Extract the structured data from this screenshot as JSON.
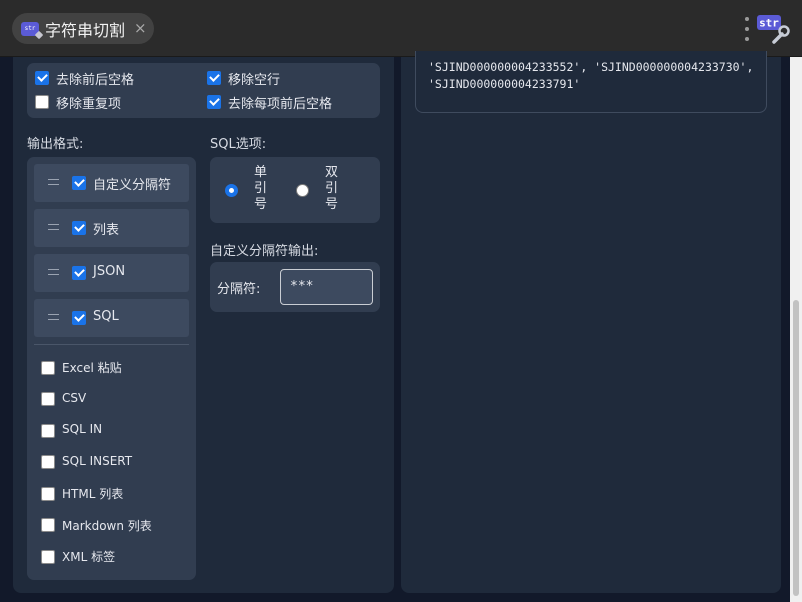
{
  "titlebar": {
    "tab_icon_text": "str",
    "tab_title": "字符串切割",
    "close_glyph": "×",
    "logo_text": "str"
  },
  "options": {
    "trim": {
      "label": "去除前后空格",
      "checked": true
    },
    "remove_empty_lines": {
      "label": "移除空行",
      "checked": true
    },
    "dedupe": {
      "label": "移除重复项",
      "checked": false
    },
    "trim_each": {
      "label": "去除每项前后空格",
      "checked": true
    }
  },
  "output_format": {
    "heading": "输出格式:",
    "selected": [
      {
        "label": "自定义分隔符",
        "checked": true
      },
      {
        "label": "列表",
        "checked": true
      },
      {
        "label": "JSON",
        "checked": true
      },
      {
        "label": "SQL",
        "checked": true
      }
    ],
    "available": [
      {
        "label": "Excel 粘贴",
        "checked": false
      },
      {
        "label": "CSV",
        "checked": false
      },
      {
        "label": "SQL IN",
        "checked": false
      },
      {
        "label": "SQL INSERT",
        "checked": false
      },
      {
        "label": "HTML 列表",
        "checked": false
      },
      {
        "label": "Markdown 列表",
        "checked": false
      },
      {
        "label": "XML 标签",
        "checked": false
      }
    ]
  },
  "sql_options": {
    "heading": "SQL选项:",
    "single_quote": {
      "label": "单引号",
      "selected": true
    },
    "double_quote": {
      "label": "双引号",
      "selected": false
    }
  },
  "custom_separator": {
    "heading": "自定义分隔符输出:",
    "field_label": "分隔符:",
    "value": "***"
  },
  "output": {
    "line1": "'SJIND000000004233552', 'SJIND000000004233730',",
    "line2": "'SJIND000000004233791'"
  },
  "colors": {
    "accent": "#1a73e8",
    "panel": "#1f2a3b",
    "card": "#313d50",
    "logo": "#5b5bd6"
  }
}
